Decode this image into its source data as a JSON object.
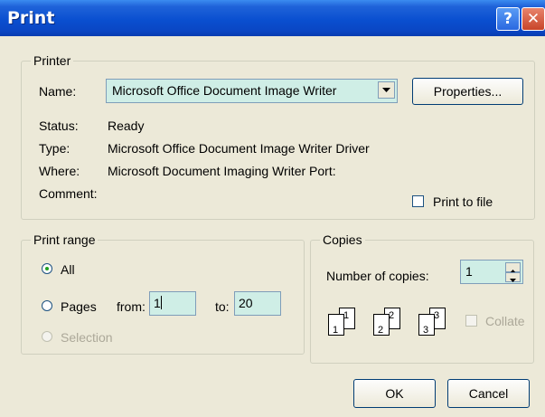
{
  "window": {
    "title": "Print",
    "help_symbol": "?",
    "close_symbol": "✕"
  },
  "printer": {
    "legend": "Printer",
    "name_label": "Name:",
    "name_value": "Microsoft Office Document Image Writer",
    "properties_button": "Properties...",
    "status_label": "Status:",
    "status_value": "Ready",
    "type_label": "Type:",
    "type_value": "Microsoft Office Document Image Writer Driver",
    "where_label": "Where:",
    "where_value": "Microsoft Document Imaging Writer Port:",
    "comment_label": "Comment:",
    "print_to_file_label": "Print to file",
    "print_to_file_checked": false
  },
  "print_range": {
    "legend": "Print range",
    "all_label": "All",
    "pages_label": "Pages",
    "from_label": "from:",
    "from_value": "1",
    "to_label": "to:",
    "to_value": "20",
    "selection_label": "Selection",
    "selected": "all"
  },
  "copies": {
    "legend": "Copies",
    "number_label": "Number of copies:",
    "number_value": "1",
    "collate_label": "Collate",
    "collate_checked": false,
    "collate_icon_pages": [
      "1",
      "1",
      "2",
      "2",
      "3",
      "3"
    ]
  },
  "buttons": {
    "ok": "OK",
    "cancel": "Cancel"
  },
  "colors": {
    "titlebar": "#0a4fd0",
    "dialog_bg": "#ece9d8",
    "field_bg": "#cfeee6",
    "radio_dot": "#21a121"
  }
}
